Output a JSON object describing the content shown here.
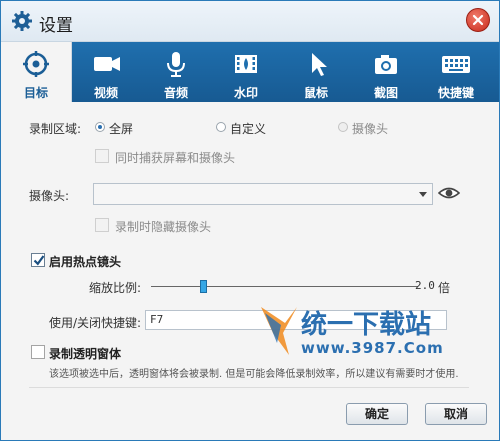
{
  "window": {
    "title": "设置"
  },
  "tabs": [
    {
      "label": "目标",
      "icon": "target-icon",
      "active": true
    },
    {
      "label": "视频",
      "icon": "video-camera-icon",
      "active": false
    },
    {
      "label": "音频",
      "icon": "microphone-icon",
      "active": false
    },
    {
      "label": "水印",
      "icon": "watermark-icon",
      "active": false
    },
    {
      "label": "鼠标",
      "icon": "mouse-pointer-icon",
      "active": false
    },
    {
      "label": "截图",
      "icon": "camera-icon",
      "active": false
    },
    {
      "label": "快捷键",
      "icon": "keyboard-icon",
      "active": false
    }
  ],
  "record_area": {
    "label": "录制区域:",
    "options": [
      "全屏",
      "自定义",
      "摄像头"
    ],
    "selected": "全屏",
    "capture_both": "同时捕获屏幕和摄像头"
  },
  "camera": {
    "label": "摄像头:",
    "value": "",
    "hide_while_recording": "录制时隐藏摄像头"
  },
  "hotspot": {
    "label": "启用热点镜头",
    "checked": true,
    "zoom_label": "缩放比例:",
    "zoom_value": "2.0",
    "zoom_unit": "倍",
    "zoom_level": 0.18,
    "shortcut_label": "使用/关闭快捷键:",
    "shortcut_value": "F7"
  },
  "transparent": {
    "label": "录制透明窗体",
    "checked": false,
    "description": "该选项被选中后，透明窗体将会被录制. 但是可能会降低录制效率，所以建议有需要时才使用."
  },
  "watermark": {
    "line1": "统一下载站",
    "line2": "www.3987.Com"
  },
  "buttons": {
    "ok": "确定",
    "cancel": "取消"
  },
  "colors": {
    "tabbar": "#1f6fae",
    "accent": "#2b6fb0",
    "close": "#c8291a"
  }
}
